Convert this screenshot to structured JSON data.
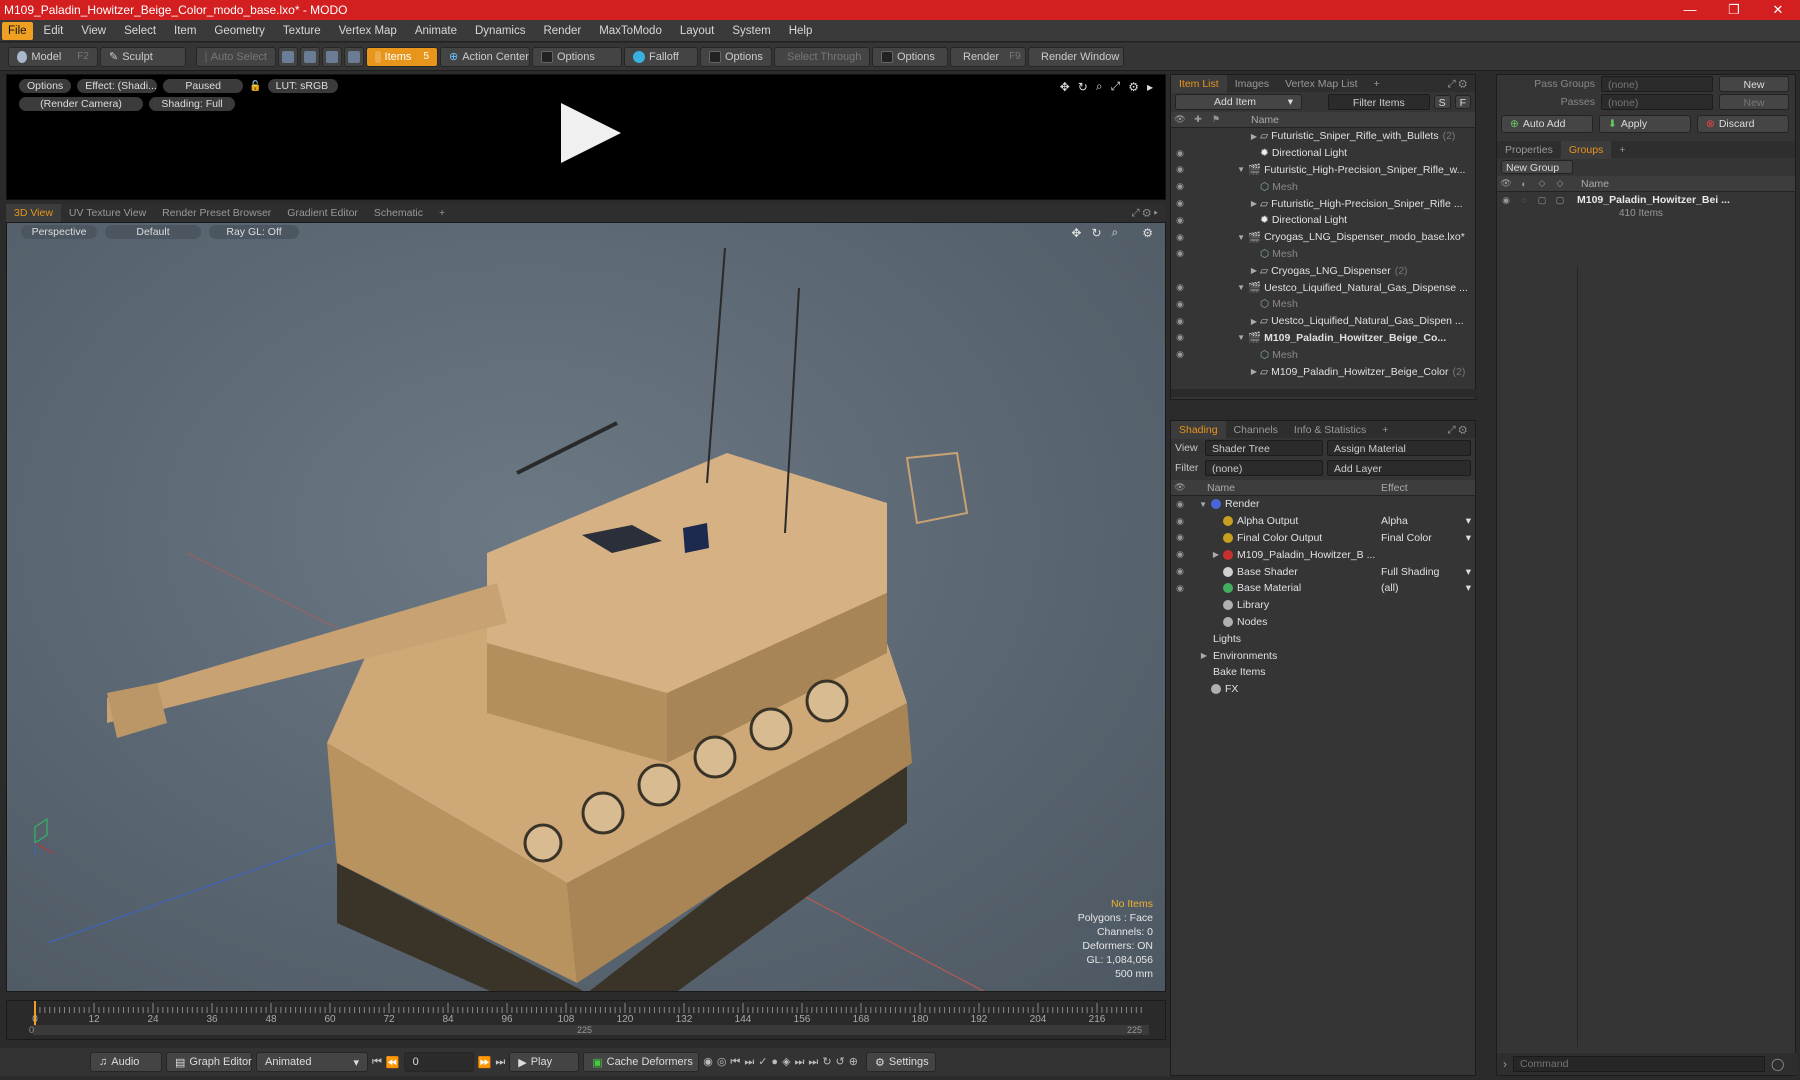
{
  "window": {
    "title": "M109_Paladin_Howitzer_Beige_Color_modo_base.lxo* - MODO",
    "controls": [
      "—",
      "❐",
      "✕"
    ]
  },
  "menu": [
    "File",
    "Edit",
    "View",
    "Select",
    "Item",
    "Geometry",
    "Texture",
    "Vertex Map",
    "Animate",
    "Dynamics",
    "Render",
    "MaxToModo",
    "Layout",
    "System",
    "Help"
  ],
  "toolbar": {
    "model": "Model",
    "model_key": "F2",
    "sculpt": "Sculpt",
    "auto_select": "Auto Select",
    "items": "Items",
    "items_key": "5",
    "action_center": "Action Center",
    "options1": "Options",
    "falloff": "Falloff",
    "options2": "Options",
    "select_through": "Select Through",
    "options3": "Options",
    "render": "Render",
    "render_key": "F9",
    "render_window": "Render Window"
  },
  "render_panel": {
    "options": "Options",
    "effect": "Effect: (Shadi...",
    "paused": "Paused",
    "lut": "LUT: sRGB",
    "camera": "(Render Camera)",
    "shading": "Shading: Full"
  },
  "viewport_tabs": [
    "3D View",
    "UV Texture View",
    "Render Preset Browser",
    "Gradient Editor",
    "Schematic"
  ],
  "viewport": {
    "perspective": "Perspective",
    "default": "Default",
    "raygl": "Ray GL: Off",
    "info": {
      "no_items": "No Items",
      "polygons": "Polygons : Face",
      "channels": "Channels: 0",
      "deformers": "Deformers: ON",
      "gl": "GL: 1,084,056",
      "size": "500 mm"
    }
  },
  "timeline": {
    "ticks": [
      "0",
      "12",
      "24",
      "36",
      "48",
      "60",
      "72",
      "84",
      "96",
      "108",
      "120",
      "132",
      "144",
      "156",
      "168",
      "180",
      "192",
      "204",
      "216"
    ],
    "start": "0",
    "mid": "225",
    "end": "225"
  },
  "bottombar": {
    "audio": "Audio",
    "graph_editor": "Graph Editor",
    "animated": "Animated",
    "frame": "0",
    "play": "Play",
    "cache_deformers": "Cache Deformers",
    "settings": "Settings"
  },
  "item_list": {
    "tabs": [
      "Item List",
      "Images",
      "Vertex Map List"
    ],
    "add_item": "Add Item",
    "filter_items": "Filter Items",
    "col_name": "Name",
    "rows": [
      {
        "label": "Futuristic_Sniper_Rifle_with_Bullets",
        "count": "(2)",
        "indent": 2,
        "kind": "group",
        "arrow": "▶"
      },
      {
        "label": "Directional Light",
        "count": "",
        "indent": 2,
        "kind": "light",
        "arrow": ""
      },
      {
        "label": "Futuristic_High-Precision_Sniper_Rifle_w...",
        "count": "",
        "indent": 1,
        "kind": "scene",
        "arrow": "▼"
      },
      {
        "label": "Mesh",
        "count": "",
        "indent": 2,
        "kind": "mesh",
        "arrow": ""
      },
      {
        "label": "Futuristic_High-Precision_Sniper_Rifle ...",
        "count": "",
        "indent": 2,
        "kind": "group",
        "arrow": "▶"
      },
      {
        "label": "Directional Light",
        "count": "",
        "indent": 2,
        "kind": "light",
        "arrow": ""
      },
      {
        "label": "Cryogas_LNG_Dispenser_modo_base.lxo*",
        "count": "",
        "indent": 1,
        "kind": "scene",
        "arrow": "▼"
      },
      {
        "label": "Mesh",
        "count": "",
        "indent": 2,
        "kind": "mesh",
        "arrow": ""
      },
      {
        "label": "Cryogas_LNG_Dispenser",
        "count": "(2)",
        "indent": 2,
        "kind": "group",
        "arrow": "▶"
      },
      {
        "label": "Uestco_Liquified_Natural_Gas_Dispense ...",
        "count": "",
        "indent": 1,
        "kind": "scene",
        "arrow": "▼"
      },
      {
        "label": "Mesh",
        "count": "",
        "indent": 2,
        "kind": "mesh",
        "arrow": ""
      },
      {
        "label": "Uestco_Liquified_Natural_Gas_Dispen ...",
        "count": "",
        "indent": 2,
        "kind": "group",
        "arrow": "▶"
      },
      {
        "label": "M109_Paladin_Howitzer_Beige_Co...",
        "count": "",
        "indent": 1,
        "kind": "scene",
        "arrow": "▼",
        "bold": true
      },
      {
        "label": "Mesh",
        "count": "",
        "indent": 2,
        "kind": "mesh",
        "arrow": ""
      },
      {
        "label": "M109_Paladin_Howitzer_Beige_Color",
        "count": "(2)",
        "indent": 2,
        "kind": "group",
        "arrow": "▶"
      }
    ]
  },
  "shading": {
    "tabs": [
      "Shading",
      "Channels",
      "Info & Statistics"
    ],
    "view_label": "View",
    "view_value": "Shader Tree",
    "assign_material": "Assign Material",
    "filter_label": "Filter",
    "filter_value": "(none)",
    "add_layer": "Add Layer",
    "col_name": "Name",
    "col_effect": "Effect",
    "rows": [
      {
        "label": "Render",
        "effect": "",
        "indent": 0,
        "color": "#4a66d6",
        "arrow": "▼",
        "eye": true
      },
      {
        "label": "Alpha Output",
        "effect": "Alpha",
        "indent": 1,
        "color": "#c8a020",
        "arrow": "",
        "eye": true
      },
      {
        "label": "Final Color Output",
        "effect": "Final Color",
        "indent": 1,
        "color": "#c8a020",
        "arrow": "",
        "eye": true
      },
      {
        "label": "M109_Paladin_Howitzer_B ...",
        "effect": "",
        "indent": 1,
        "color": "#c83030",
        "arrow": "▶",
        "eye": true
      },
      {
        "label": "Base Shader",
        "effect": "Full Shading",
        "indent": 1,
        "color": "#d0d0d0",
        "arrow": "",
        "eye": true
      },
      {
        "label": "Base Material",
        "effect": "(all)",
        "indent": 1,
        "color": "#40b060",
        "arrow": "",
        "eye": true
      },
      {
        "label": "Library",
        "effect": "",
        "indent": 1,
        "color": "#b0b0b0",
        "arrow": "",
        "eye": false
      },
      {
        "label": "Nodes",
        "effect": "",
        "indent": 1,
        "color": "#b0b0b0",
        "arrow": "",
        "eye": false
      },
      {
        "label": "Lights",
        "effect": "",
        "indent": 0,
        "color": "",
        "arrow": "",
        "eye": false
      },
      {
        "label": "Environments",
        "effect": "",
        "indent": 0,
        "color": "",
        "arrow": "▶",
        "eye": false
      },
      {
        "label": "Bake Items",
        "effect": "",
        "indent": 0,
        "color": "",
        "arrow": "",
        "eye": false
      },
      {
        "label": "FX",
        "effect": "",
        "indent": 0,
        "color": "#b0b0b0",
        "arrow": "",
        "eye": false
      }
    ]
  },
  "groups_panel": {
    "pass_groups_label": "Pass Groups",
    "pass_groups_value": "(none)",
    "new": "New",
    "passes_label": "Passes",
    "passes_value": "(none)",
    "new2": "New",
    "auto_add": "Auto Add",
    "apply": "Apply",
    "discard": "Discard",
    "tabs": [
      "Properties",
      "Groups"
    ],
    "new_group": "New Group",
    "col_name": "Name",
    "group_name": "M109_Paladin_Howitzer_Bei ...",
    "group_count": "410 Items",
    "command_placeholder": "Command"
  }
}
